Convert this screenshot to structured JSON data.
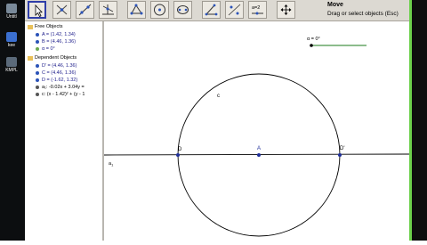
{
  "desktop": {
    "icons": [
      {
        "label": "Untitl",
        "color": "#7a8a9a"
      },
      {
        "label": "kee",
        "color": "#3b6fd0"
      },
      {
        "label": "KMPL",
        "color": "#5b6a7a"
      }
    ]
  },
  "toolbar": {
    "tools": [
      "move",
      "new-point",
      "line-through-points",
      "perpendicular-line",
      "polygon",
      "circle",
      "conic",
      "angle",
      "reflect",
      "slider",
      "translate-view"
    ],
    "slider_label": "a=2",
    "tip_title": "Move",
    "tip_text": "Drag or select objects (Esc)"
  },
  "algebra": {
    "free_header": "Free Objects",
    "free_items": [
      "A = (1.42, 1.34)",
      "B = (4.46, 1.36)",
      "α = 0°"
    ],
    "dependent_header": "Dependent Objects",
    "dependent_items": [
      "D' = (4.46, 1.36)",
      "C = (4.46, 1.36)",
      "D = (-1.62, 1.32)",
      "a₁: -0.02x + 3.04y =",
      "c: (x - 1.42)² + (y - 1"
    ]
  },
  "canvas": {
    "label_A": "A",
    "label_D": "D",
    "label_Dp": "D'",
    "label_c": "c",
    "label_a1": "a",
    "label_a1_sub": "1",
    "slider_text": "α = 0°",
    "colors": {
      "point": "#1f2f9a",
      "line": "#000000",
      "slider": "#1a7a1a"
    }
  }
}
